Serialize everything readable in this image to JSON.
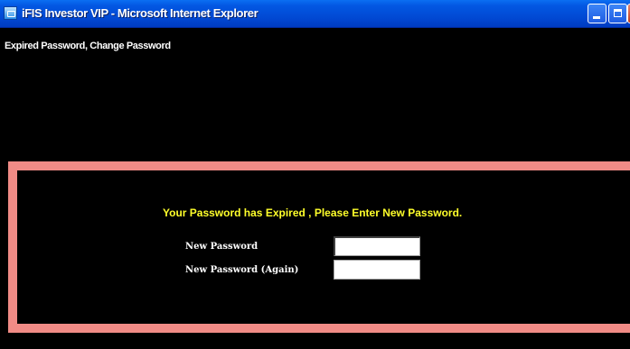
{
  "window": {
    "title": "iFIS Investor VIP - Microsoft Internet Explorer",
    "icon": "internet-explorer-icon",
    "controls": [
      "minimize",
      "maximize",
      "close"
    ]
  },
  "page": {
    "heading": "Expired Password, Change Password"
  },
  "panel": {
    "border_color": "#f08b86",
    "message": "Your Password has Expired , Please Enter New Password.",
    "message_color": "#ffff2a",
    "fields": [
      {
        "label": "New Password",
        "value": ""
      },
      {
        "label": "New Password (Again)",
        "value": ""
      }
    ]
  }
}
